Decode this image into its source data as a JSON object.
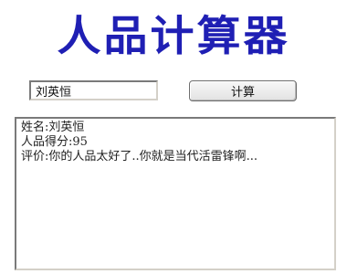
{
  "app": {
    "title": "人品计算器"
  },
  "form": {
    "name_value": "刘英恒",
    "calculate_label": "计算"
  },
  "result": {
    "lines": [
      "姓名:刘英恒",
      "人品得分:95",
      "评价:你的人品太好了..你就是当代活雷锋啊..."
    ]
  },
  "colors": {
    "title": "#1f1fb4",
    "text": "#222222"
  }
}
